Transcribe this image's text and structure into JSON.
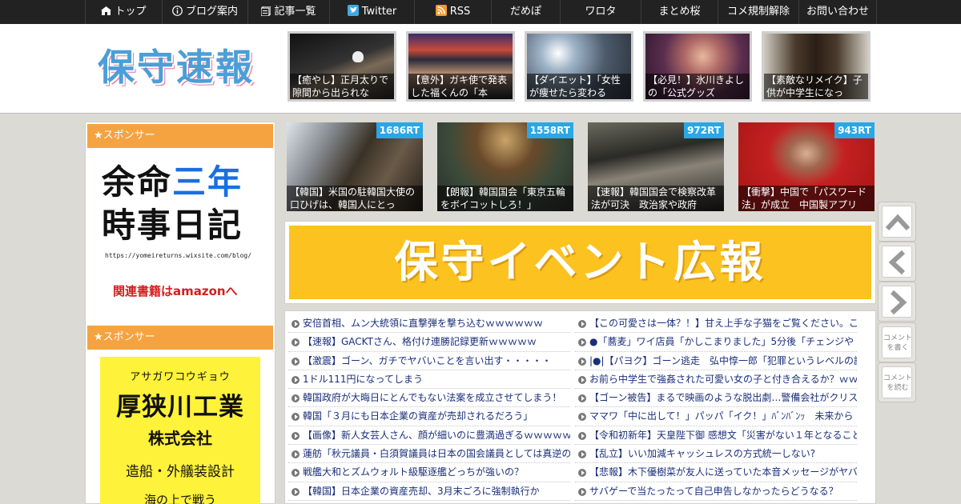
{
  "nav": {
    "items": [
      {
        "label": "トップ",
        "icon": "home-icon"
      },
      {
        "label": "ブログ案内",
        "icon": "info-icon"
      },
      {
        "label": "記事一覧",
        "icon": "list-icon"
      },
      {
        "label": "Twitter",
        "icon": "twitter-icon"
      },
      {
        "label": "RSS",
        "icon": "rss-icon"
      },
      {
        "label": "だめぽ",
        "icon": ""
      },
      {
        "label": "ワロタ",
        "icon": ""
      },
      {
        "label": "まとめ桜",
        "icon": ""
      },
      {
        "label": "コメ規制解除",
        "icon": ""
      },
      {
        "label": "お問い合わせ",
        "icon": ""
      }
    ]
  },
  "header": {
    "logo": "保守速報",
    "thumbs": [
      {
        "caption": "【癒やし】正月太りで隙間から出られな"
      },
      {
        "caption": "【意外】ガキ使で発表した福くんの「本"
      },
      {
        "caption": "【ダイエット】「女性が痩せたら変わる"
      },
      {
        "caption": "【必見！】氷川きよしの「公式グッズ"
      },
      {
        "caption": "【素敵なリメイク】子供が中学生になっ"
      }
    ]
  },
  "sidebar": {
    "sponsor_label_1": "★スポンサー",
    "ad1": {
      "line1_a": "余命",
      "line1_b": "三年",
      "line2": "時事日記",
      "url": "https://yomeireturns.wixsite.com/blog/",
      "amazon": "関連書籍はamazonへ"
    },
    "sponsor_label_2": "★スポンサー",
    "ad2": {
      "kana": "アサガワコウギョウ",
      "name": "厚狭川工業",
      "corp": "株式会社",
      "biz": "造船・外艤装設計",
      "slogan": "海の上で戦う"
    }
  },
  "ranking": [
    {
      "rt": "1686RT",
      "caption": "【韓国】米国の駐韓国大使の口ひげは、韓国人にとっ"
    },
    {
      "rt": "1558RT",
      "caption": "【朗報】韓国国会「東京五輪をボイコットしろ！」"
    },
    {
      "rt": "972RT",
      "caption": "【速報】韓国国会で検察改革法が可決　政治家や政府"
    },
    {
      "rt": "943RT",
      "caption": "【衝撃】中国で「パスワード法」が成立　中国製アプリ"
    }
  ],
  "banner": {
    "title": "保守イベント広報"
  },
  "list_left": [
    "安倍首相、ムン大統領に直撃弾を撃ち込むｗｗｗｗｗｗ",
    "【速報】GACKTさん、格付け連勝記録更新ｗｗｗｗｗ",
    "【激震】ゴーン、ガチでヤバいことを言い出す・・・・・",
    "1ドル111円になってしまう",
    "韓国政府が大晦日にとんでもない法案を成立させてしまう！",
    "韓国「３月にも日本企業の資産が売却されるだろう」",
    "【画像】新人女芸人さん、顔が細いのに豊満過ぎるｗｗｗｗｗ",
    "蓮舫「秋元議員・白須賀議員は日本の国会議員としては真逆の",
    "戦艦大和とズムウォルト級駆逐艦どっちが強いの？",
    "【韓国】日本企業の資産売却、3月末ごろに強制執行か"
  ],
  "list_right": [
    "【この可愛さは一体？！】甘え上手な子猫をご覧ください。こ",
    "●「蕎麦」ワイ店員「かしこまりました」5分後「チェンジや",
    "|●|【パヨク】ゴーン逃走　弘中惇一郎「犯罪というレベルの話",
    "お前ら中学生で強姦された可愛い女の子と付き合えるか？ｗｗ",
    "【ゴーン被告】まるで映画のような脱出劇…警備会社がクリス",
    "ママワ「中に出して！」パッパ「イク！」ﾊﾞﾝﾊﾞﾝｯ　未来から",
    "【令和初新年】天皇陛下御 感想文「災害がない１年となること",
    "【乱立】いい加減キャッシュレスの方式統一しない?",
    "【悲報】木下優樹菜が友人に送っていた本音メッセージがヤバ",
    "サバゲーで当たったって自己申告しなかったらどうなる？"
  ],
  "float_buttons": {
    "write_comment": "コメントを書く",
    "read_comment": "コメントを読む"
  }
}
